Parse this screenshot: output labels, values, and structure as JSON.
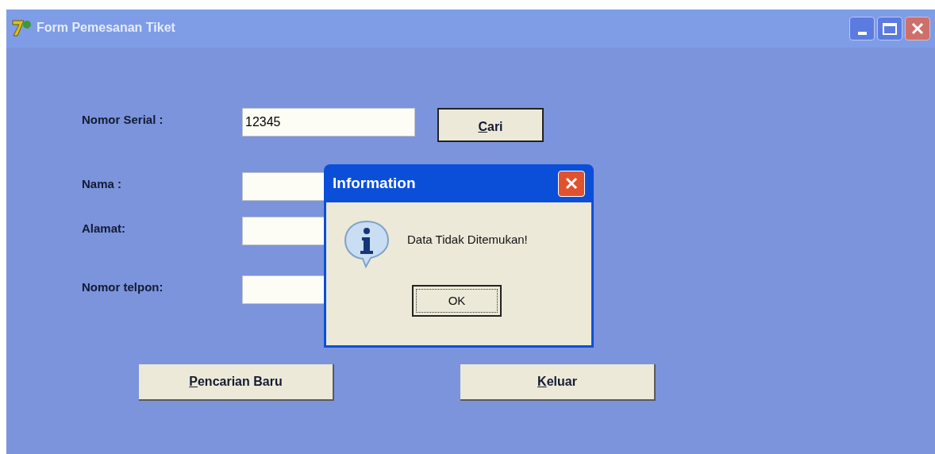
{
  "window": {
    "title": "Form Pemesanan Tiket"
  },
  "fields": [
    {
      "label": "Nomor Serial :",
      "value": "12345"
    },
    {
      "label": "Nama :"
    },
    {
      "label": "Alamat:"
    },
    {
      "label": "Nomor telpon:"
    }
  ],
  "search_button": {
    "label": "Cari",
    "underline_first": true
  },
  "buttons": [
    {
      "label": "Pencarian Baru",
      "underline_first": true
    },
    {
      "label": "Keluar",
      "underline_first": true
    }
  ],
  "dialog": {
    "title": "Information",
    "message": "Data Tidak Ditemukan!",
    "button": "OK",
    "focused": true
  }
}
